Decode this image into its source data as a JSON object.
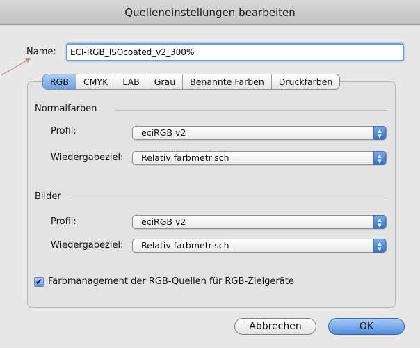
{
  "window": {
    "title": "Quelleneinstellungen bearbeiten"
  },
  "name": {
    "label": "Name:",
    "value": "ECI-RGB_ISOcoated_v2_300%"
  },
  "tabs": [
    {
      "label": "RGB",
      "active": true
    },
    {
      "label": "CMYK",
      "active": false
    },
    {
      "label": "LAB",
      "active": false
    },
    {
      "label": "Grau",
      "active": false
    },
    {
      "label": "Benannte Farben",
      "active": false
    },
    {
      "label": "Druckfarben",
      "active": false
    }
  ],
  "normal": {
    "title": "Normalfarben",
    "profile_label": "Profil:",
    "profile_value": "eciRGB v2",
    "intent_label": "Wiedergabeziel:",
    "intent_value": "Relativ farbmetrisch"
  },
  "images": {
    "title": "Bilder",
    "profile_label": "Profil:",
    "profile_value": "eciRGB v2",
    "intent_label": "Wiedergabeziel:",
    "intent_value": "Relativ farbmetrisch"
  },
  "checkbox": {
    "label": "Farbmanagement der RGB-Quellen für RGB-Zielgeräte",
    "checked": true
  },
  "buttons": {
    "cancel": "Abbrechen",
    "ok": "OK"
  },
  "colors": {
    "accent": "#6aa3e6",
    "leader_line": "#c98a8a"
  }
}
